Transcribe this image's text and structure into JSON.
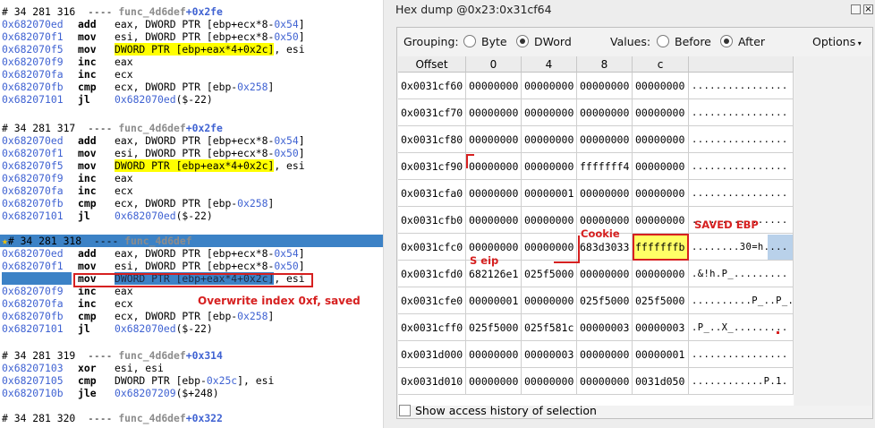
{
  "left": {
    "blocks": [
      {
        "header": {
          "prefix": "# 34 281 316  ---- ",
          "func": "func_4d6def",
          "offset": "+0x2fe"
        },
        "lines": [
          {
            "addr": "0x682070ed",
            "mn": "add",
            "op": [
              {
                "t": "eax, DWORD PTR [ebp+ecx*8-"
              },
              {
                "t": "0x54",
                "c": "b"
              },
              {
                "t": "]"
              }
            ]
          },
          {
            "addr": "0x682070f1",
            "mn": "mov",
            "op": [
              {
                "t": "esi, DWORD PTR [ebp+ecx*8-"
              },
              {
                "t": "0x50",
                "c": "b"
              },
              {
                "t": "]"
              }
            ]
          },
          {
            "addr": "0x682070f5",
            "mn": "mov",
            "op": [
              {
                "t": "DWORD PTR [ebp+eax*4+0x2c]",
                "c": "h"
              },
              {
                "t": ", esi"
              }
            ]
          },
          {
            "addr": "0x682070f9",
            "mn": "inc",
            "op": [
              {
                "t": "eax"
              }
            ]
          },
          {
            "addr": "0x682070fa",
            "mn": "inc",
            "op": [
              {
                "t": "ecx"
              }
            ]
          },
          {
            "addr": "0x682070fb",
            "mn": "cmp",
            "op": [
              {
                "t": "ecx, DWORD PTR [ebp-"
              },
              {
                "t": "0x258",
                "c": "b"
              },
              {
                "t": "]"
              }
            ]
          },
          {
            "addr": "0x68207101",
            "mn": "jl",
            "op": [
              {
                "t": "0x682070ed",
                "c": "b"
              },
              {
                "t": "($-22)"
              }
            ]
          }
        ]
      },
      {
        "header": {
          "prefix": "# 34 281 317  ---- ",
          "func": "func_4d6def",
          "offset": "+0x2fe"
        },
        "lines": [
          {
            "addr": "0x682070ed",
            "mn": "add",
            "op": [
              {
                "t": "eax, DWORD PTR [ebp+ecx*8-"
              },
              {
                "t": "0x54",
                "c": "b"
              },
              {
                "t": "]"
              }
            ]
          },
          {
            "addr": "0x682070f1",
            "mn": "mov",
            "op": [
              {
                "t": "esi, DWORD PTR [ebp+ecx*8-"
              },
              {
                "t": "0x50",
                "c": "b"
              },
              {
                "t": "]"
              }
            ]
          },
          {
            "addr": "0x682070f5",
            "mn": "mov",
            "op": [
              {
                "t": "DWORD PTR [ebp+eax*4+0x2c]",
                "c": "h"
              },
              {
                "t": ", esi"
              }
            ]
          },
          {
            "addr": "0x682070f9",
            "mn": "inc",
            "op": [
              {
                "t": "eax"
              }
            ]
          },
          {
            "addr": "0x682070fa",
            "mn": "inc",
            "op": [
              {
                "t": "ecx"
              }
            ]
          },
          {
            "addr": "0x682070fb",
            "mn": "cmp",
            "op": [
              {
                "t": "ecx, DWORD PTR [ebp-"
              },
              {
                "t": "0x258",
                "c": "b"
              },
              {
                "t": "]"
              }
            ]
          },
          {
            "addr": "0x68207101",
            "mn": "jl",
            "op": [
              {
                "t": "0x682070ed",
                "c": "b"
              },
              {
                "t": "($-22)"
              }
            ]
          }
        ]
      },
      {
        "header": {
          "prefix": "# 34 281 318  ---- ",
          "func": "func_4d6def",
          "offset": "+0x2fe"
        },
        "selected": true,
        "lines": [
          {
            "addr": "0x682070ed",
            "mn": "add",
            "op": [
              {
                "t": "eax, DWORD PTR [ebp+ecx*8-"
              },
              {
                "t": "0x54",
                "c": "b"
              },
              {
                "t": "]"
              }
            ]
          },
          {
            "addr": "0x682070f1",
            "mn": "mov",
            "op": [
              {
                "t": "esi, DWORD PTR [ebp+ecx*8-"
              },
              {
                "t": "0x50",
                "c": "b"
              },
              {
                "t": "]"
              }
            ]
          },
          {
            "addr": "0x682070f5",
            "mn": "mov",
            "sel": true,
            "op": [
              {
                "t": "DWORD PTR [ebp+eax*4+0x2c]",
                "c": "s"
              },
              {
                "t": ", esi"
              }
            ]
          },
          {
            "addr": "0x682070f9",
            "mn": "inc",
            "op": [
              {
                "t": "eax"
              }
            ]
          },
          {
            "addr": "0x682070fa",
            "mn": "inc",
            "op": [
              {
                "t": "ecx"
              }
            ]
          },
          {
            "addr": "0x682070fb",
            "mn": "cmp",
            "op": [
              {
                "t": "ecx, DWORD PTR [ebp-"
              },
              {
                "t": "0x258",
                "c": "b"
              },
              {
                "t": "]"
              }
            ]
          },
          {
            "addr": "0x68207101",
            "mn": "jl",
            "op": [
              {
                "t": "0x682070ed",
                "c": "b"
              },
              {
                "t": "($-22)"
              }
            ]
          }
        ]
      },
      {
        "header": {
          "prefix": "# 34 281 319  ---- ",
          "func": "func_4d6def",
          "offset": "+0x314"
        },
        "lines": [
          {
            "addr": "0x68207103",
            "mn": "xor",
            "op": [
              {
                "t": "esi, esi"
              }
            ]
          },
          {
            "addr": "0x68207105",
            "mn": "cmp",
            "op": [
              {
                "t": "DWORD PTR [ebp-"
              },
              {
                "t": "0x25c",
                "c": "b"
              },
              {
                "t": "], esi"
              }
            ]
          },
          {
            "addr": "0x6820710b",
            "mn": "jle",
            "op": [
              {
                "t": "0x68207209",
                "c": "b"
              },
              {
                "t": "($+248)"
              }
            ]
          }
        ]
      },
      {
        "header": {
          "prefix": "# 34 281 320  ---- ",
          "func": "func_4d6def",
          "offset": "+0x322"
        },
        "lines": []
      }
    ],
    "annotation": "Overwrite index 0xf, saved"
  },
  "right": {
    "title": "Hex dump @0x23:0x31cf64",
    "grouping_label": "Grouping:",
    "byte_label": "Byte",
    "dword_label": "DWord",
    "values_label": "Values:",
    "before_label": "Before",
    "after_label": "After",
    "options_label": "Options",
    "columns": [
      "Offset",
      "0",
      "4",
      "8",
      "c"
    ],
    "rows": [
      [
        "0x0031cf60",
        "00000000",
        "00000000",
        "00000000",
        "00000000",
        "................"
      ],
      [
        "0x0031cf70",
        "00000000",
        "00000000",
        "00000000",
        "00000000",
        "................"
      ],
      [
        "0x0031cf80",
        "00000000",
        "00000000",
        "00000000",
        "00000000",
        "................"
      ],
      [
        "0x0031cf90",
        "00000000",
        "00000000",
        "fffffff4",
        "00000000",
        "................"
      ],
      [
        "0x0031cfa0",
        "00000000",
        "00000001",
        "00000000",
        "00000000",
        "................"
      ],
      [
        "0x0031cfb0",
        "00000000",
        "00000000",
        "00000000",
        "00000000",
        "................"
      ],
      [
        "0x0031cfc0",
        "00000000",
        "00000000",
        "683d3033",
        "fffffffb",
        "........30=h...."
      ],
      [
        "0x0031cfd0",
        "682126e1",
        "025f5000",
        "00000000",
        "00000000",
        ".&!h.P_........."
      ],
      [
        "0x0031cfe0",
        "00000001",
        "00000000",
        "025f5000",
        "025f5000",
        "..........P_..P_."
      ],
      [
        "0x0031cff0",
        "025f5000",
        "025f581c",
        "00000003",
        "00000003",
        ".P_..X_........."
      ],
      [
        "0x0031d000",
        "00000000",
        "00000003",
        "00000000",
        "00000001",
        "................"
      ],
      [
        "0x0031d010",
        "00000000",
        "00000000",
        "00000000",
        "0031d050",
        "............P.1."
      ]
    ],
    "footer_label": "Show access history of selection",
    "annotations": {
      "cookie": "Cookie",
      "saved_ebp": "SAVED EBP",
      "seip": "S eip"
    }
  }
}
